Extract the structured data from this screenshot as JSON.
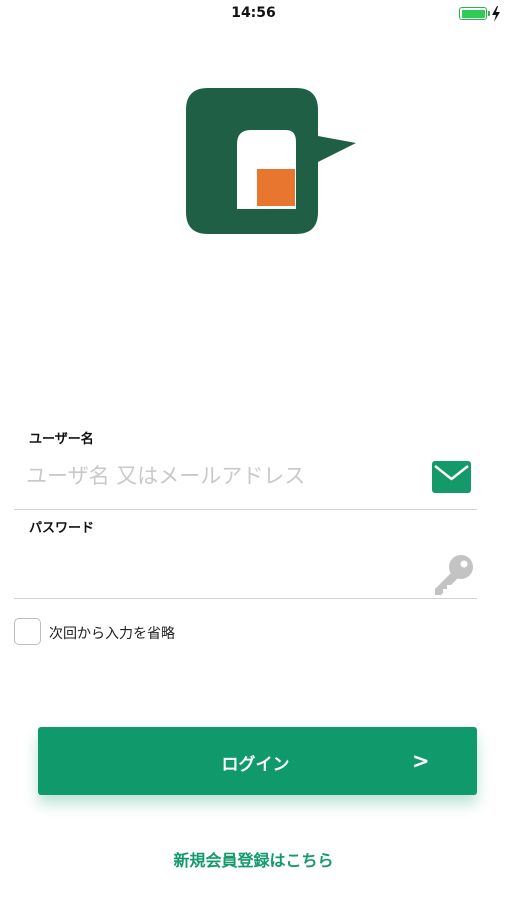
{
  "status_bar": {
    "time": "14:56",
    "battery_level": 1.0,
    "charging_icon": "bolt-icon"
  },
  "logo": {
    "icon": "logo-mark",
    "frame_color": "#1f5f45",
    "accent_color": "#e8762e"
  },
  "form": {
    "username": {
      "label": "ユーザー名",
      "placeholder": "ユーザ名 又はメールアドレス",
      "value": "",
      "icon": "mail-icon"
    },
    "password": {
      "label": "パスワード",
      "placeholder": "",
      "value": "",
      "icon": "key-icon"
    },
    "remember": {
      "label": "次回から入力を省略",
      "checked": false
    }
  },
  "login_button": {
    "label": "ログイン",
    "chevron": ">"
  },
  "register_link": {
    "label": "新規会員登録はこちら"
  },
  "colors": {
    "accent": "#10996b",
    "mail_icon": "#14996b",
    "key_icon": "#c3c3c3",
    "divider": "#d2d2d2"
  }
}
